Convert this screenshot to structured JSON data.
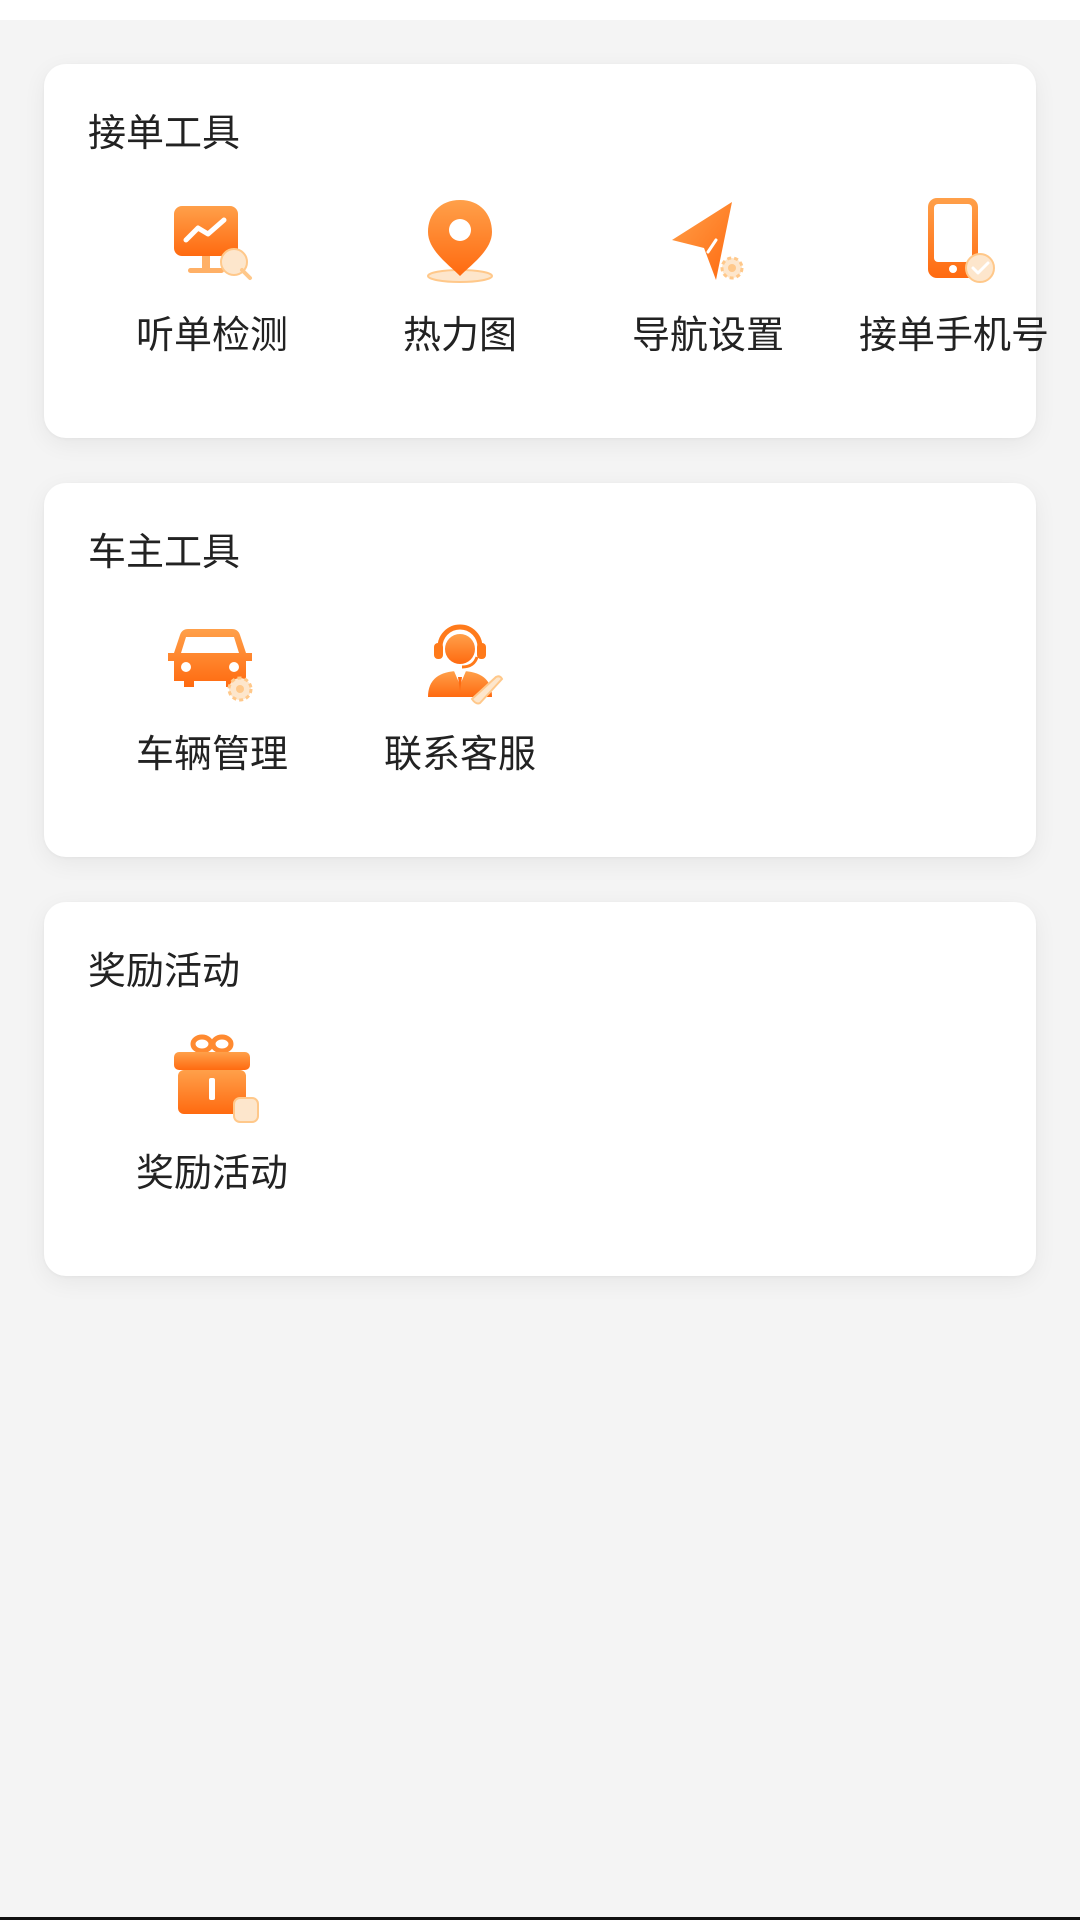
{
  "sections": [
    {
      "title": "接单工具",
      "items": [
        {
          "label": "听单检测",
          "icon": "monitor-chart-icon"
        },
        {
          "label": "热力图",
          "icon": "map-pin-icon"
        },
        {
          "label": "导航设置",
          "icon": "navigation-arrow-icon"
        },
        {
          "label": "接单手机号",
          "icon": "phone-check-icon"
        }
      ]
    },
    {
      "title": "车主工具",
      "items": [
        {
          "label": "车辆管理",
          "icon": "car-gear-icon"
        },
        {
          "label": "联系客服",
          "icon": "customer-service-icon"
        }
      ]
    },
    {
      "title": "奖励活动",
      "items": [
        {
          "label": "奖励活动",
          "icon": "gift-icon"
        }
      ]
    }
  ],
  "colors": {
    "accent": "#ff7a1a",
    "accent_light": "#ffb066",
    "badge": "#fde6cc",
    "background": "#f4f4f4",
    "card": "#ffffff",
    "text": "#222222"
  }
}
